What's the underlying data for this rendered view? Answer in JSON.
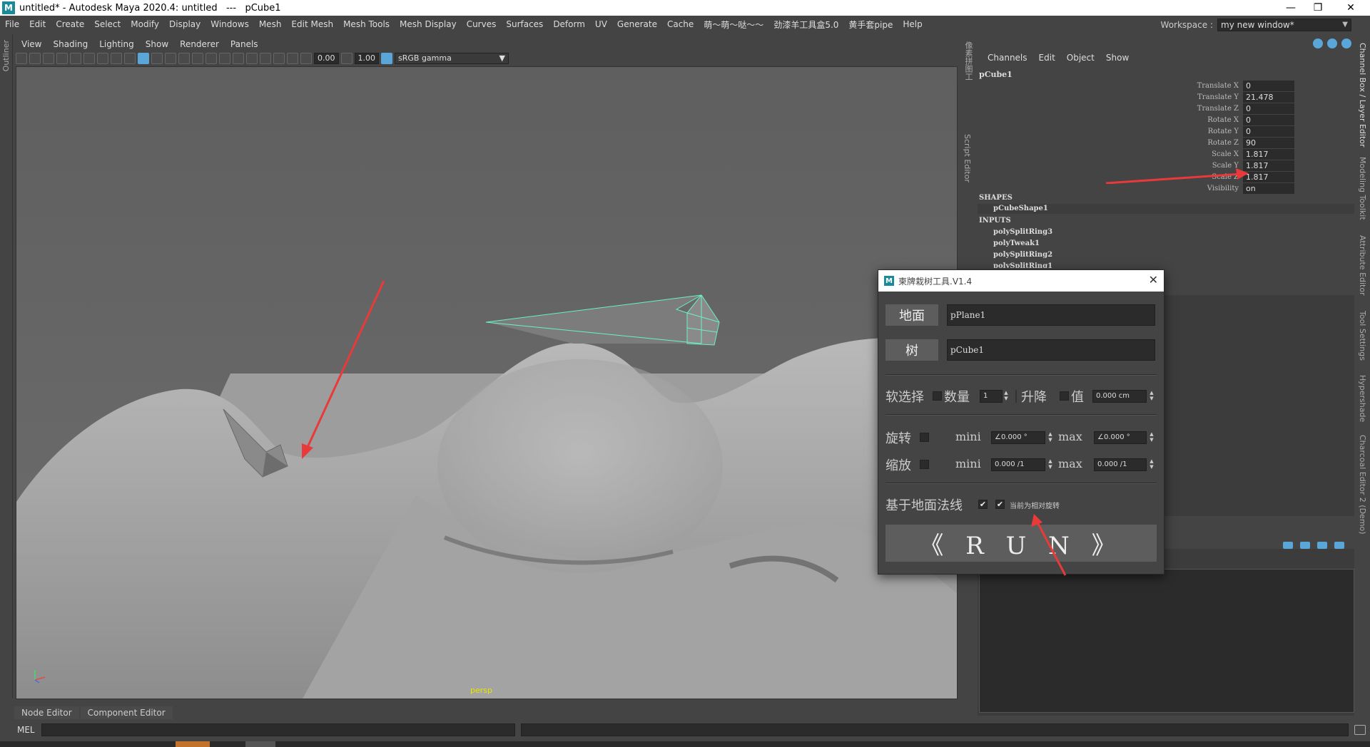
{
  "window": {
    "title": "untitled* - Autodesk Maya 2020.4: untitled   ---   pCube1",
    "logo": "M",
    "controls": [
      "—",
      "❐",
      "✕"
    ]
  },
  "menubar": {
    "items": [
      "File",
      "Edit",
      "Create",
      "Select",
      "Modify",
      "Display",
      "Windows",
      "Mesh",
      "Edit Mesh",
      "Mesh Tools",
      "Mesh Display",
      "Curves",
      "Surfaces",
      "Deform",
      "UV",
      "Generate",
      "Cache",
      "萌～萌～哒～～",
      "劲漆羊工具盒5.0",
      "黄手套pipe",
      "Help"
    ]
  },
  "workspace": {
    "label": "Workspace :",
    "value": "my new window*"
  },
  "left_strip": {
    "label": "Outliner"
  },
  "viewport": {
    "menu": [
      "View",
      "Shading",
      "Lighting",
      "Show",
      "Renderer",
      "Panels"
    ],
    "exposure": "0.00",
    "gamma": "1.00",
    "color_space": "sRGB gamma",
    "camera_label": "persp"
  },
  "mid_strip": {
    "label1": "像素拼图工",
    "label2": "Script Editor"
  },
  "right_strip": {
    "labels": [
      "Channel Box / Layer Editor",
      "Modeling Toolkit",
      "Attribute Editor",
      "Tool Settings",
      "Hypershade",
      "Charcoal Editor 2 (Demo)"
    ]
  },
  "channel_box": {
    "menu": [
      "Channels",
      "Edit",
      "Object",
      "Show"
    ],
    "object": "pCube1",
    "attributes": [
      {
        "name": "Translate X",
        "value": "0"
      },
      {
        "name": "Translate Y",
        "value": "21.478"
      },
      {
        "name": "Translate Z",
        "value": "0"
      },
      {
        "name": "Rotate X",
        "value": "0"
      },
      {
        "name": "Rotate Y",
        "value": "0"
      },
      {
        "name": "Rotate Z",
        "value": "90"
      },
      {
        "name": "Scale X",
        "value": "1.817"
      },
      {
        "name": "Scale Y",
        "value": "1.817"
      },
      {
        "name": "Scale Z",
        "value": "1.817"
      },
      {
        "name": "Visibility",
        "value": "on"
      }
    ],
    "shapes_header": "SHAPES",
    "shapes": [
      "pCubeShape1"
    ],
    "inputs_header": "INPUTS",
    "inputs": [
      "polySplitRing3",
      "polyTweak1",
      "polySplitRing2",
      "polySplitRing1"
    ]
  },
  "bottom_tabs": [
    "Node Editor",
    "Component Editor"
  ],
  "command_line": {
    "label": "MEL"
  },
  "dialog": {
    "title": "柬牌栽树工具.V1.4",
    "ground_label": "地面",
    "ground_value": "pPlane1",
    "tree_label": "树",
    "tree_value": "pCube1",
    "soft_select_label": "软选择",
    "count_label": "数量",
    "count_value": "1",
    "lift_label": "升降",
    "value_label": "值",
    "lift_value": "0.000 cm",
    "rotate_label": "旋转",
    "scale_label": "缩放",
    "mini_label": "mini",
    "max_label": "max",
    "rot_min": "∠0.000 °",
    "rot_max": "∠0.000 °",
    "scale_min": "0.000 /1",
    "scale_max": "0.000 /1",
    "normal_label": "基于地面法线",
    "relative_label": "当前为相对旋转",
    "run_label": "《 R U N 》",
    "check": "✔"
  }
}
